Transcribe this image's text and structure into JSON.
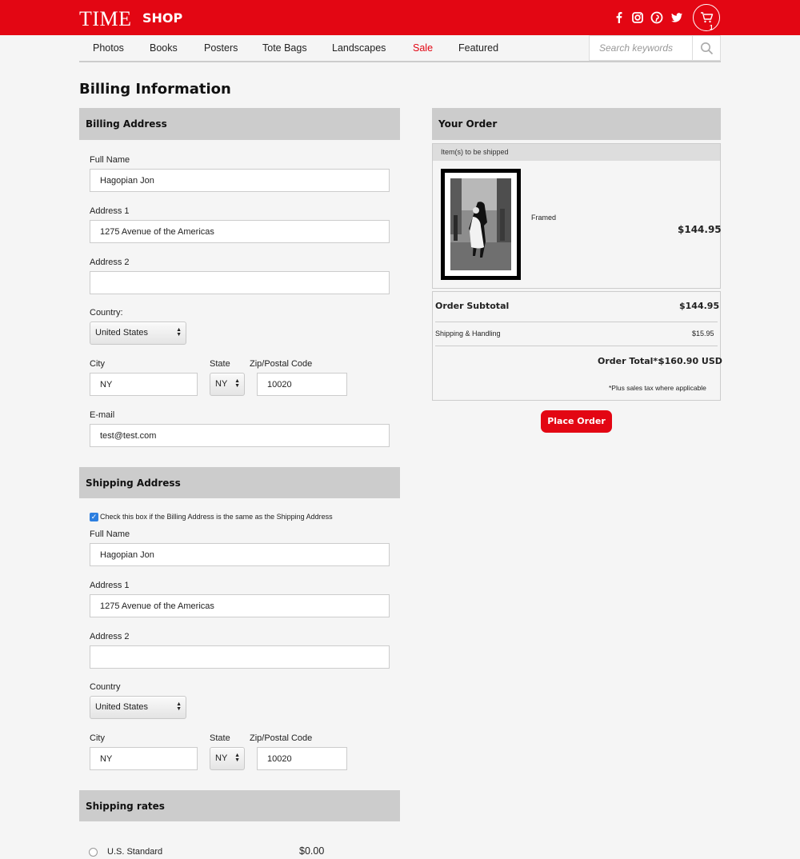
{
  "header": {
    "logo": "TIME",
    "logo_sub": "SHOP",
    "social_icons": [
      "facebook-icon",
      "instagram-icon",
      "pinterest-icon",
      "twitter-icon"
    ],
    "cart_count": "1",
    "brand_color": "#e30613"
  },
  "nav": {
    "items": [
      "Photos",
      "Books",
      "Posters",
      "Tote Bags",
      "Landscapes",
      "Sale",
      "Featured"
    ],
    "search_placeholder": "Search keywords"
  },
  "page_title": "Billing Information",
  "billing": {
    "heading": "Billing Address",
    "full_name_label": "Full Name",
    "full_name": "Hagopian Jon",
    "address1_label": "Address 1",
    "address1": "1275 Avenue of the Americas",
    "address2_label": "Address 2",
    "address2": "",
    "country_label": "Country:",
    "country": "United States",
    "city_label": "City",
    "city": "NY",
    "state_label": "State",
    "state": "NY",
    "zip_label": "Zip/Postal Code",
    "zip": "10020",
    "email_label": "E-mail",
    "email": "test@test.com"
  },
  "shipping": {
    "heading": "Shipping Address",
    "same_as_billing_label": "Check this box if the Billing Address is the same as the Shipping Address",
    "same_as_billing_checked": true,
    "full_name_label": "Full Name",
    "full_name": "Hagopian Jon",
    "address1_label": "Address 1",
    "address1": "1275 Avenue of the Americas",
    "address2_label": "Address 2",
    "address2": "",
    "country_label": "Country",
    "country": "United States",
    "city_label": "City",
    "city": "NY",
    "state_label": "State",
    "state": "NY",
    "zip_label": "Zip/Postal Code",
    "zip": "10020"
  },
  "shipping_rates": {
    "heading": "Shipping rates",
    "options": [
      {
        "label": "U.S. Standard",
        "price": "$0.00",
        "selected": false
      }
    ]
  },
  "order": {
    "heading": "Your Order",
    "items_heading": "Item(s) to be shipped",
    "item": {
      "variant": "Framed",
      "price": "$144.95"
    },
    "subtotal_label": "Order Subtotal",
    "subtotal": "$144.95",
    "shipping_label": "Shipping & Handling",
    "shipping": "$15.95",
    "total_label": "Order Total*:",
    "total": "$160.90 USD",
    "tax_note": "*Plus sales tax where applicable",
    "place_order_label": "Place Order"
  }
}
